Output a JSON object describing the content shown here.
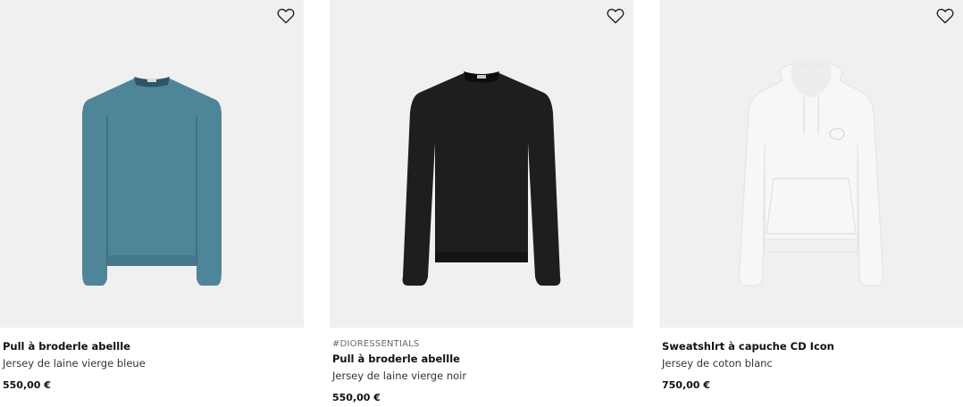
{
  "products": [
    {
      "tag": "",
      "title": "Pull à broderle abellle",
      "subtitle": "Jersey de laine vierge bleue",
      "price": "550,00 €",
      "garment": "sweater",
      "color": "#4f8599",
      "icon": "heart-outline-icon"
    },
    {
      "tag": "#DIORESSENTIALS",
      "title": "Pull à broderle abellle",
      "subtitle": "Jersey de laine vierge noir",
      "price": "550,00 €",
      "garment": "sweater",
      "color": "#1e1e1e",
      "icon": "heart-outline-icon"
    },
    {
      "tag": "",
      "title": "Sweatshlrt à capuche CD Icon",
      "subtitle": "Jersey de coton blanc",
      "price": "750,00 €",
      "garment": "hoodie",
      "color": "#f7f7f7",
      "icon": "heart-outline-icon"
    }
  ],
  "colors": {
    "image_background": "#f0f0f0",
    "text": "#111111",
    "tag_text": "#6a6a6a"
  }
}
